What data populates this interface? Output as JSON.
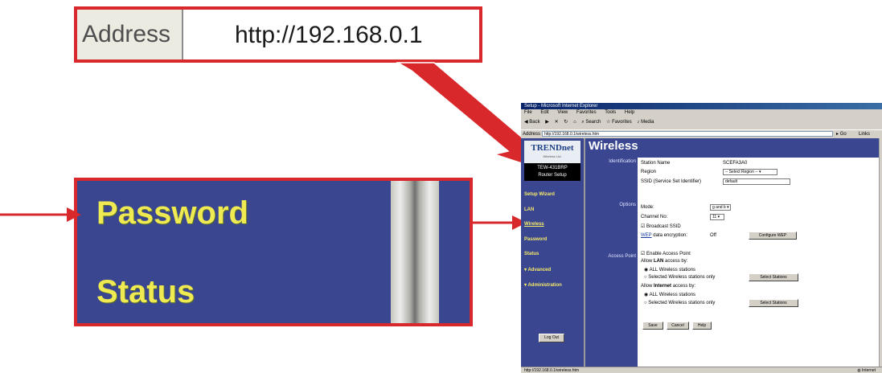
{
  "callout_address": {
    "label": "Address",
    "value": "http://192.168.0.1"
  },
  "callout_sidebar": {
    "item1": "Password",
    "item2": "Status"
  },
  "browser": {
    "title": "Setup - Microsoft Internet Explorer",
    "menu": [
      "File",
      "Edit",
      "View",
      "Favorites",
      "Tools",
      "Help"
    ],
    "toolbar": {
      "back": "Back",
      "search": "Search",
      "favorites": "Favorites",
      "media": "Media"
    },
    "address_label": "Address",
    "address_value": "http://192.168.0.1/wireless.htm",
    "go": "Go",
    "links": "Links",
    "status": "http://192.168.0.1/wireless.htm",
    "status_zone": "Internet"
  },
  "router": {
    "logo": "TRENDnet",
    "logo_sub": "Wireless Ltd.",
    "model": "TEW-431BRP",
    "model_sub": "Router Setup",
    "nav": [
      "Setup Wizard",
      "LAN",
      "Wireless",
      "Password",
      "Status",
      "▾ Advanced",
      "▾ Administration"
    ],
    "logout": "Log Out",
    "page_title": "Wireless",
    "sections": {
      "identification": "Identification",
      "options": "Options",
      "access_point": "Access Point"
    },
    "identification": {
      "station_name_label": "Station Name",
      "station_name_value": "SCEFA3A0",
      "region_label": "Region",
      "region_value": "-- Select Region --",
      "ssid_label": "SSID (Service Set Identifier)",
      "ssid_value": "default"
    },
    "options": {
      "mode_label": "Mode:",
      "mode_value": "g and b",
      "channel_label": "Channel No:",
      "channel_value": "11",
      "broadcast_ssid": "Broadcast SSID",
      "wep_link": "WEP",
      "wep_label": "data encryption:",
      "wep_value": "Off",
      "configure_wep": "Configure WEP"
    },
    "access_point": {
      "enable": "Enable Access Point",
      "allow_lan_prefix": "Allow",
      "allow_lan_bold": "LAN",
      "allow_lan_suffix": "access by:",
      "all_wireless": "ALL Wireless stations",
      "selected_wireless": "Selected Wireless stations only",
      "select_stations": "Select Stations",
      "allow_internet_prefix": "Allow",
      "allow_internet_bold": "Internet",
      "allow_internet_suffix": "access by:"
    },
    "buttons": {
      "save": "Save",
      "cancel": "Cancel",
      "help": "Help"
    }
  },
  "colors": {
    "callout_border": "#d8282b",
    "router_bg": "#3a4690",
    "nav_text": "#f5e96a"
  }
}
